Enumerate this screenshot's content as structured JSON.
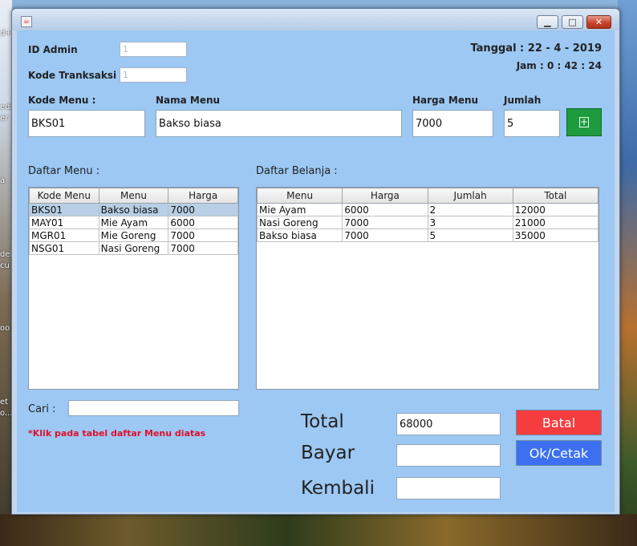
{
  "desktop": {
    "fragments": [
      "d+",
      "edi",
      "er",
      "a",
      "del",
      "cu",
      "oo",
      "et",
      "o..."
    ]
  },
  "window": {
    "icon": "java-cup-icon",
    "buttons": [
      "minimize",
      "maximize",
      "close"
    ]
  },
  "header": {
    "id_admin_label": "ID Admin",
    "id_admin_value": "1",
    "kode_transaksi_label": "Kode Tranksaksi",
    "kode_transaksi_value": "1",
    "tanggal": "Tanggal : 22 - 4 - 2019",
    "jam": "Jam : 0 : 42 : 24"
  },
  "form": {
    "kode_menu_label": "Kode Menu :",
    "kode_menu_value": "BKS01",
    "nama_menu_label": "Nama Menu",
    "nama_menu_value": "Bakso biasa",
    "harga_menu_label": "Harga Menu",
    "harga_menu_value": "7000",
    "jumlah_label": "Jumlah",
    "jumlah_value": "5",
    "add_button": "+"
  },
  "daftar_menu": {
    "title": "Daftar Menu :",
    "columns": [
      "Kode Menu",
      "Menu",
      "Harga"
    ],
    "rows": [
      [
        "BKS01",
        "Bakso biasa",
        "7000"
      ],
      [
        "MAY01",
        "Mie Ayam",
        "6000"
      ],
      [
        "MGR01",
        "Mie Goreng",
        "7000"
      ],
      [
        "NSG01",
        "Nasi Goreng",
        "7000"
      ]
    ],
    "selected_row": 0
  },
  "daftar_belanja": {
    "title": "Daftar Belanja :",
    "columns": [
      "Menu",
      "Harga",
      "Jumlah",
      "Total"
    ],
    "rows": [
      [
        "Mie Ayam",
        "6000",
        "2",
        "12000"
      ],
      [
        "Nasi Goreng",
        "7000",
        "3",
        "21000"
      ],
      [
        "Bakso biasa",
        "7000",
        "5",
        "35000"
      ]
    ]
  },
  "search": {
    "label": "Cari :",
    "value": "",
    "hint": "*Klik pada tabel daftar Menu diatas"
  },
  "payment": {
    "total_label": "Total",
    "total_value": "68000",
    "bayar_label": "Bayar",
    "bayar_value": "",
    "kembali_label": "Kembali",
    "kembali_value": "",
    "batal_button": "Batal",
    "ok_button": "Ok/Cetak"
  },
  "colors": {
    "panel": "#9cc8f3",
    "add": "#1f9b3f",
    "batal": "#f53c3e",
    "ok": "#3c70f0",
    "hint": "#e0102a"
  }
}
